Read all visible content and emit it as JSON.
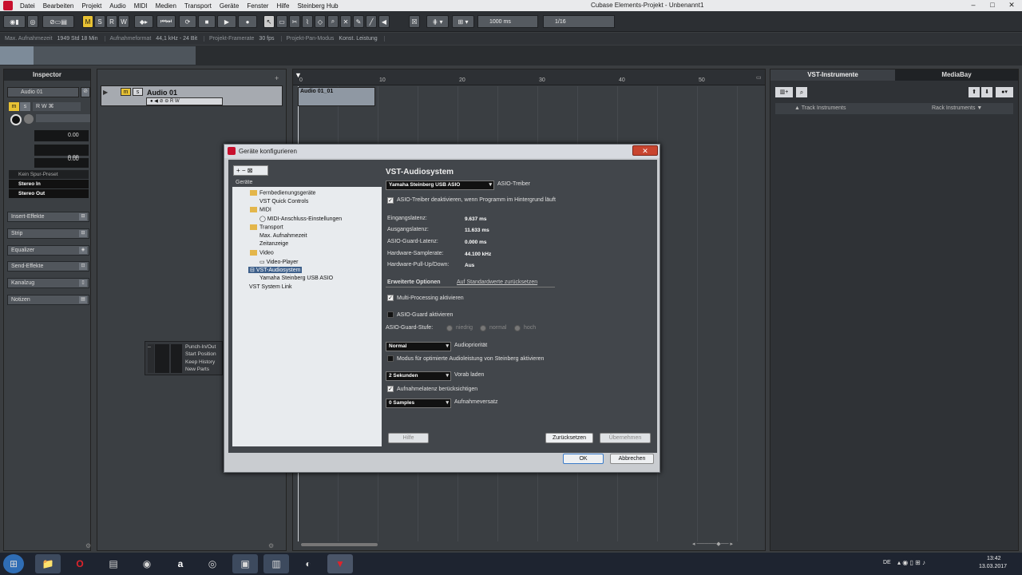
{
  "menubar": {
    "items": [
      "Datei",
      "Bearbeiten",
      "Projekt",
      "Audio",
      "MIDI",
      "Medien",
      "Transport",
      "Geräte",
      "Fenster",
      "Hilfe",
      "Steinberg Hub"
    ],
    "window_title": "Cubase Elements-Projekt - Unbenannt1",
    "controls": [
      "–",
      "□",
      "✕"
    ]
  },
  "toolbar": {
    "mode_buttons": [
      "M",
      "S",
      "R",
      "W"
    ],
    "snap_value": "1000 ms",
    "quantize_value": "1/16"
  },
  "infoline": {
    "max_rec_label": "Max. Aufnahmezeit",
    "max_rec_value": "1949 Std 18 Min",
    "rec_format_label": "Aufnahmeformat",
    "rec_format_value": "44,1 kHz - 24 Bit",
    "framerate_label": "Projekt-Framerate",
    "framerate_value": "30 fps",
    "pan_label": "Projekt-Pan-Modus",
    "pan_value": "Konst. Leistung"
  },
  "inspector": {
    "title": "Inspector",
    "track_name": "Audio 01",
    "val1": "0.00",
    "val2": "0.00",
    "val3": "0.00",
    "preset": "Kein Spur-Preset",
    "input": "Stereo In",
    "output": "Stereo Out",
    "sections": [
      "Insert-Effekte",
      "Strip",
      "Equalizer",
      "Send-Effekte",
      "Kanalzug",
      "Notizen"
    ]
  },
  "tracklist": {
    "track_name": "Audio 01",
    "track_buttons": [
      "m",
      "s"
    ]
  },
  "arrange": {
    "ruler": [
      "0",
      "10",
      "20",
      "30",
      "40",
      "50"
    ],
    "event_name": "Audio 01_01"
  },
  "rightzone": {
    "tab1": "VST-Instrumente",
    "tab2": "MediaBay",
    "track_instruments": "Track Instruments",
    "rack_instruments": "Rack Instruments"
  },
  "minitransport": {
    "items": [
      "Punch-In/Out",
      "Start Position",
      "Keep History",
      "New Parts"
    ]
  },
  "dialog": {
    "title": "Geräte konfigurieren",
    "tree_header": "Geräte",
    "tree": [
      {
        "label": "Fernbedienungsgeräte",
        "level": 1,
        "folder": true
      },
      {
        "label": "VST Quick Controls",
        "level": 1,
        "folder": false
      },
      {
        "label": "MIDI",
        "level": 1,
        "folder": true
      },
      {
        "label": "MIDI-Anschluss-Einstellungen",
        "level": 2,
        "folder": false
      },
      {
        "label": "Transport",
        "level": 1,
        "folder": true
      },
      {
        "label": "Max. Aufnahmezeit",
        "level": 1,
        "folder": false
      },
      {
        "label": "Zeitanzeige",
        "level": 1,
        "folder": false
      },
      {
        "label": "Video",
        "level": 1,
        "folder": true
      },
      {
        "label": "Video-Player",
        "level": 2,
        "folder": false
      },
      {
        "label": "VST-Audiosystem",
        "level": 1,
        "folder": false,
        "selected": true
      },
      {
        "label": "Yamaha Steinberg USB ASIO",
        "level": 1,
        "folder": false
      },
      {
        "label": "VST System Link",
        "level": 0,
        "folder": false
      }
    ],
    "panel_title": "VST-Audiosystem",
    "asio_driver": "Yamaha Steinberg USB ASIO",
    "asio_driver_label": "ASIO-Treiber",
    "deactivate_label": "ASIO-Treiber deaktivieren, wenn Programm im Hintergrund läuft",
    "in_latency_label": "Eingangslatenz:",
    "in_latency": "9.637 ms",
    "out_latency_label": "Ausgangslatenz:",
    "out_latency": "11.633 ms",
    "guard_latency_label": "ASIO-Guard-Latenz:",
    "guard_latency": "0.000 ms",
    "samplerate_label": "Hardware-Samplerate:",
    "samplerate": "44.100 kHz",
    "pullup_label": "Hardware-Pull-Up/Down:",
    "pullup": "Aus",
    "advanced_label": "Erweiterte Optionen",
    "reset_defaults": "Auf Standardwerte zurücksetzen",
    "multiproc_label": "Multi-Processing aktivieren",
    "asioguard_label": "ASIO-Guard aktivieren",
    "guard_level_label": "ASIO-Guard-Stufe:",
    "guard_levels": [
      "niedrig",
      "normal",
      "hoch"
    ],
    "priority_value": "Normal",
    "priority_label": "Audiopriorität",
    "steinberg_mode_label": "Modus für optimierte Audioleistung von Steinberg aktivieren",
    "preload_value": "2 Sekunden",
    "preload_label": "Vorab laden",
    "reclatency_label": "Aufnahmelatenz berücksichtigen",
    "offset_value": "0 Samples",
    "offset_label": "Aufnahmeversatz",
    "help_btn": "Hilfe",
    "reset_btn": "Zurücksetzen",
    "apply_btn": "Übernehmen",
    "ok_btn": "OK",
    "cancel_btn": "Abbrechen"
  },
  "taskbar": {
    "lang": "DE",
    "time": "13:42",
    "date": "13.03.2017"
  }
}
